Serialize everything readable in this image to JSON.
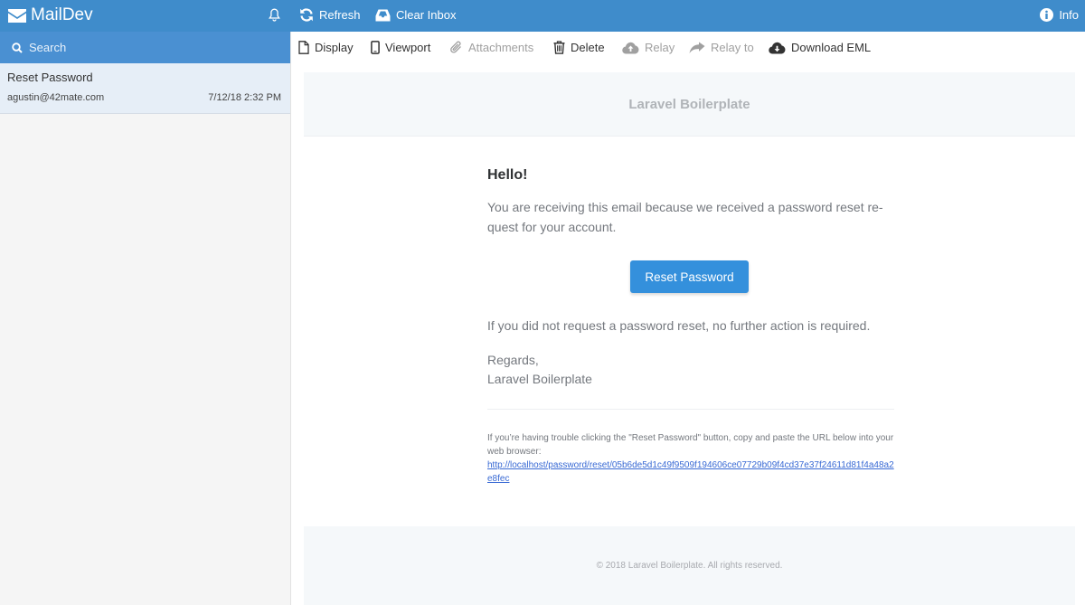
{
  "app": {
    "title": "MailDev",
    "refresh_label": "Refresh",
    "clear_inbox_label": "Clear Inbox",
    "info_label": "Info"
  },
  "sidebar": {
    "search_placeholder": "Search",
    "emails": [
      {
        "subject": "Reset Password",
        "from": "agustin@42mate.com",
        "date": "7/12/18 2:32 PM"
      }
    ]
  },
  "toolbar": {
    "display": "Display",
    "viewport": "Viewport",
    "attachments": "Attachments",
    "delete": "Delete",
    "relay": "Relay",
    "relay_to": "Relay to",
    "download_eml": "Download EML"
  },
  "email": {
    "header_title": "Laravel Boilerplate",
    "greeting": "Hello!",
    "intro": "You are receiving this email because we received a password reset re-quest for your account.",
    "button_label": "Reset Password",
    "outro": "If you did not request a password reset, no further action is required.",
    "regards": "Regards,",
    "signature": "Laravel Boilerplate",
    "subcopy": "If you’re having trouble clicking the \"Reset Password\" button, copy and paste the URL below into your web browser:",
    "link_url": "http://localhost/password/reset/05b6de5d1c49f9509f194606ce07729b09f4cd37e37f24611d81f4a48a2e8fec",
    "footer": "© 2018 Laravel Boilerplate. All rights reserved."
  },
  "colors": {
    "topbar": "#3f8ccb",
    "search_bar": "#4a90d2",
    "button": "#3490dc",
    "link": "#3869d4"
  }
}
